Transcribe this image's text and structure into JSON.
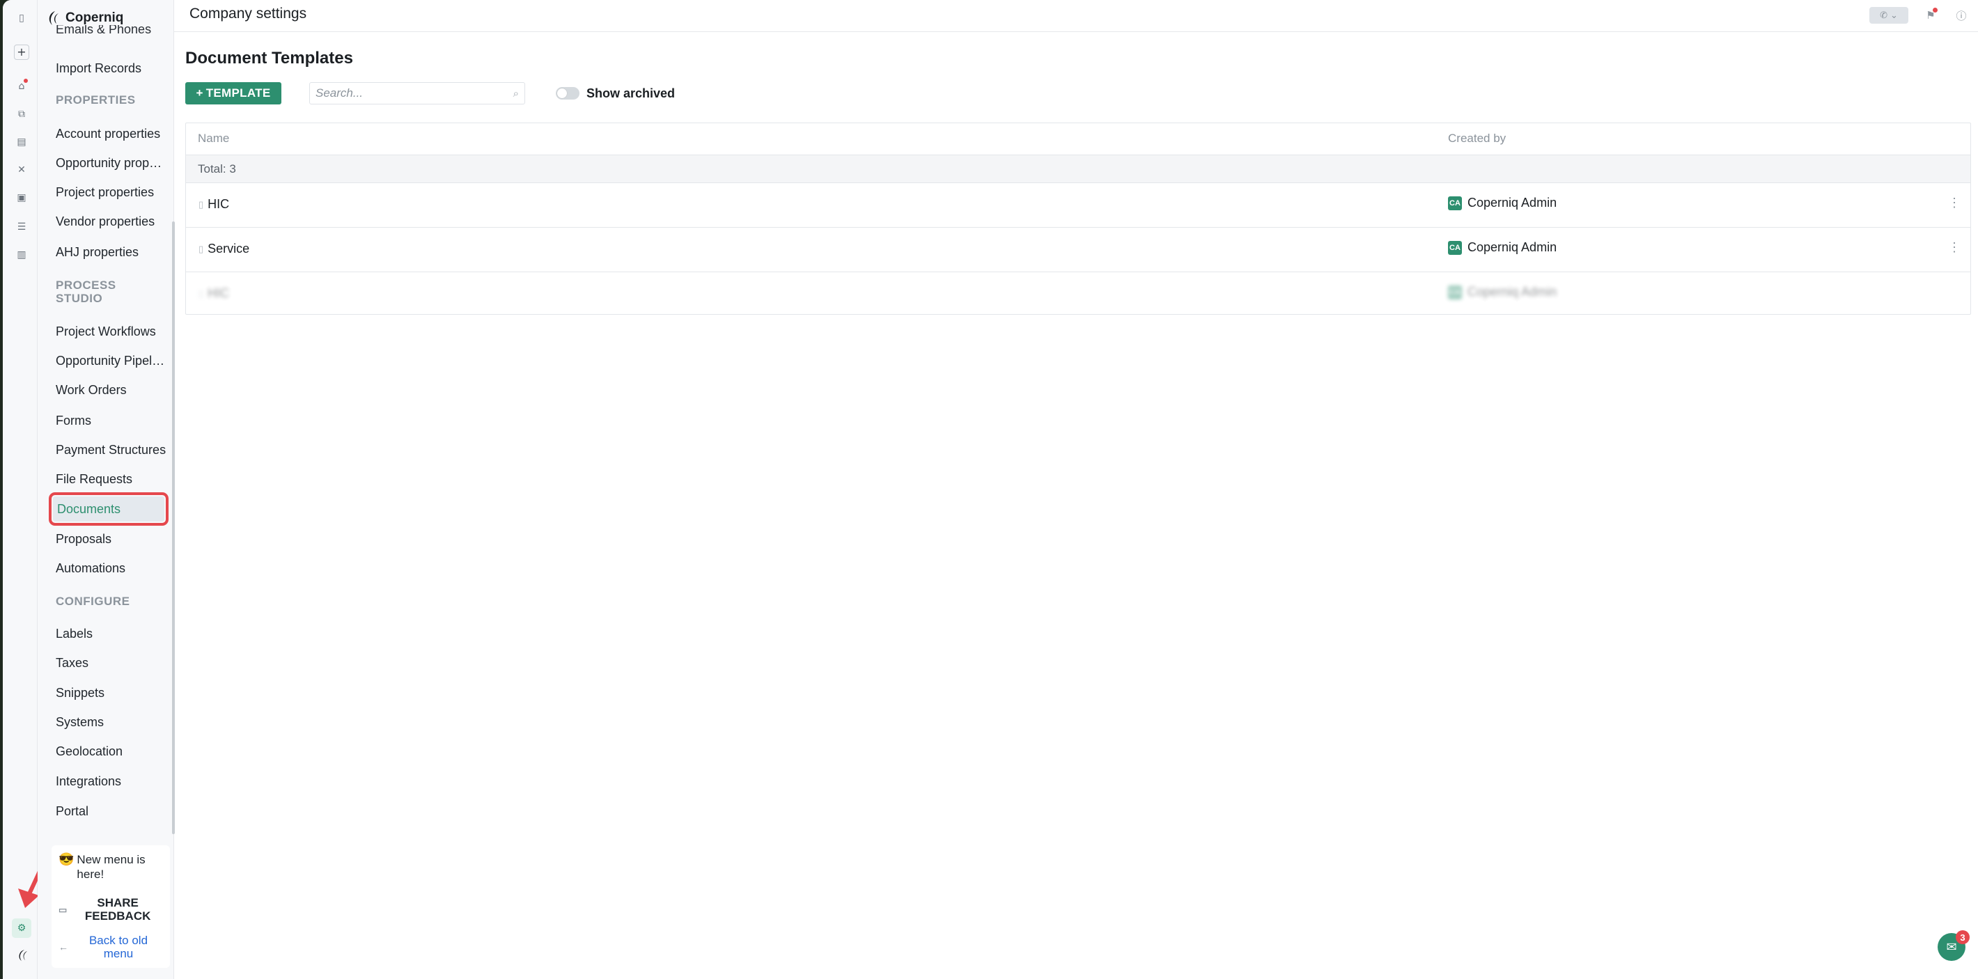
{
  "app": {
    "brand": "Coperniq"
  },
  "topbar": {
    "title": "Company settings"
  },
  "sidebar": {
    "items_top": [
      {
        "label": "Emails & Phones"
      },
      {
        "label": "Import Records"
      }
    ],
    "sections": [
      {
        "title": "PROPERTIES",
        "items": [
          {
            "label": "Account properties"
          },
          {
            "label": "Opportunity properties"
          },
          {
            "label": "Project properties"
          },
          {
            "label": "Vendor properties"
          },
          {
            "label": "AHJ properties"
          }
        ]
      },
      {
        "title": "PROCESS STUDIO",
        "items": [
          {
            "label": "Project Workflows"
          },
          {
            "label": "Opportunity Pipelines"
          },
          {
            "label": "Work Orders"
          },
          {
            "label": "Forms"
          },
          {
            "label": "Payment Structures"
          },
          {
            "label": "File Requests"
          },
          {
            "label": "Documents"
          },
          {
            "label": "Proposals"
          },
          {
            "label": "Automations"
          }
        ]
      },
      {
        "title": "CONFIGURE",
        "items": [
          {
            "label": "Labels"
          },
          {
            "label": "Taxes"
          },
          {
            "label": "Snippets"
          },
          {
            "label": "Systems"
          },
          {
            "label": "Geolocation"
          },
          {
            "label": "Integrations"
          },
          {
            "label": "Portal"
          }
        ]
      }
    ],
    "active_item": "Documents",
    "footer": {
      "promo_emoji": "😎",
      "promo_text": "New menu is here!",
      "feedback_label": "SHARE FEEDBACK",
      "back_label": "Back to old menu"
    }
  },
  "main": {
    "title": "Document Templates",
    "add_button": "TEMPLATE",
    "search_placeholder": "Search...",
    "toggle_label": "Show archived",
    "toggle_on": false,
    "table": {
      "columns": [
        "Name",
        "Created by"
      ],
      "total_label": "Total: 3",
      "rows": [
        {
          "name": "HIC",
          "created_by": "Coperniq Admin",
          "avatar": "CA"
        },
        {
          "name": "Service",
          "created_by": "Coperniq Admin",
          "avatar": "CA"
        },
        {
          "name": "HIC",
          "created_by": "Coperniq Admin",
          "avatar": "CA"
        }
      ]
    }
  },
  "chat": {
    "badge": "3"
  },
  "colors": {
    "accent": "#2d8f6f",
    "highlight": "#e5484d",
    "link": "#2467d6",
    "muted": "#8b939b"
  }
}
